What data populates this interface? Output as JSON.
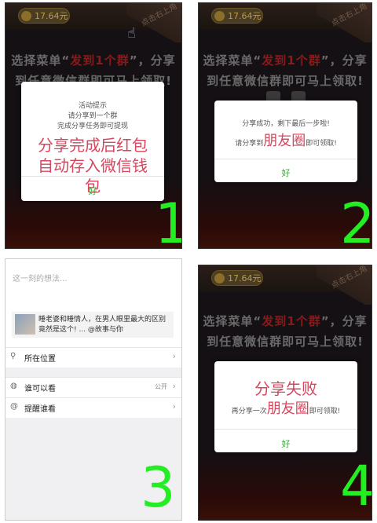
{
  "game": {
    "coin_value_1": "17.64元",
    "coin_value_2": "17.64元",
    "coin_value_4": "17.64元",
    "corner_banner": "点击右上角",
    "headline_prefix": "选择菜单“",
    "headline_red": "发到1个群",
    "headline_suffix": "”，分享",
    "headline_line2": "到任意微信群即可马上领取!"
  },
  "panel1": {
    "dialog_title": "活动提示",
    "line1": "请分享到一个群",
    "line2": "完成分享任务即可提现",
    "big_text": "分享完成后红包自动存入微信钱包",
    "ok": "好",
    "number": "1"
  },
  "panel2": {
    "line1": "分享成功，剩下最后一步啦!",
    "line2_prefix": "请分享到",
    "line2_big": "朋友圈",
    "line2_suffix": "即可领取!",
    "ok": "好",
    "number": "2"
  },
  "panel3": {
    "placeholder": "这一刻的想法...",
    "share_card_text": "睡老婆和睡情人，在男人眼里最大的区别竟然是这个! ... @故事与你",
    "location_label": "所在位置",
    "visibility_label": "谁可以看",
    "visibility_value": "公开",
    "remind_label": "提醒谁看",
    "number": "3"
  },
  "panel4": {
    "big_text": "分享失败",
    "line2_prefix": "再分享一次",
    "line2_big": "朋友圈",
    "line2_suffix": "即可领取!",
    "ok": "好",
    "number": "4"
  }
}
